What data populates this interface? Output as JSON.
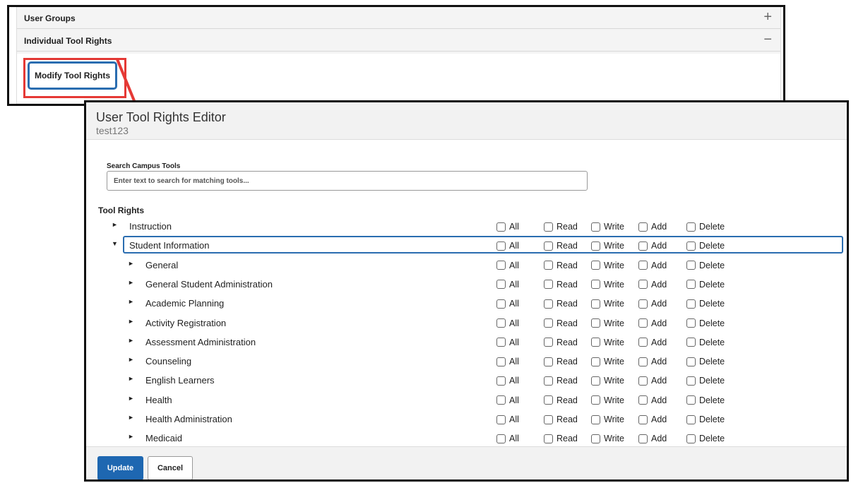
{
  "background_panel": {
    "user_groups_title": "User Groups",
    "user_groups_toggle": "+",
    "individual_tool_rights_title": "Individual Tool Rights",
    "individual_tool_rights_toggle": "−",
    "modify_button_label": "Modify Tool Rights"
  },
  "colors": {
    "accent": "#1e67b1",
    "highlight": "#e53935",
    "header_bg": "#f2f2f2"
  },
  "modal": {
    "title": "User Tool Rights Editor",
    "subtitle": "test123",
    "search_label": "Search Campus Tools",
    "search_placeholder": "Enter text to search for matching tools...",
    "search_value": "",
    "tool_rights_label": "Tool Rights",
    "permission_labels": [
      "All",
      "Read",
      "Write",
      "Add",
      "Delete"
    ],
    "rows": [
      {
        "label": "Instruction",
        "level": 0,
        "expanded": false,
        "selected": false,
        "caret": "►"
      },
      {
        "label": "Student Information",
        "level": 0,
        "expanded": true,
        "selected": true,
        "caret": "▼"
      },
      {
        "label": "General",
        "level": 1,
        "expanded": false,
        "selected": false,
        "caret": "►"
      },
      {
        "label": "General Student Administration",
        "level": 1,
        "expanded": false,
        "selected": false,
        "caret": "►"
      },
      {
        "label": "Academic Planning",
        "level": 1,
        "expanded": false,
        "selected": false,
        "caret": "►"
      },
      {
        "label": "Activity Registration",
        "level": 1,
        "expanded": false,
        "selected": false,
        "caret": "►"
      },
      {
        "label": "Assessment Administration",
        "level": 1,
        "expanded": false,
        "selected": false,
        "caret": "►"
      },
      {
        "label": "Counseling",
        "level": 1,
        "expanded": false,
        "selected": false,
        "caret": "►"
      },
      {
        "label": "English Learners",
        "level": 1,
        "expanded": false,
        "selected": false,
        "caret": "►"
      },
      {
        "label": "Health",
        "level": 1,
        "expanded": false,
        "selected": false,
        "caret": "►"
      },
      {
        "label": "Health Administration",
        "level": 1,
        "expanded": false,
        "selected": false,
        "caret": "►"
      },
      {
        "label": "Medicaid",
        "level": 1,
        "expanded": false,
        "selected": false,
        "caret": "►"
      }
    ],
    "update_label": "Update",
    "cancel_label": "Cancel"
  }
}
